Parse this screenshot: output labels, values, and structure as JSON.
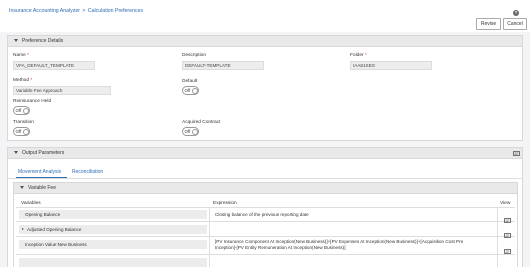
{
  "breadcrumb": {
    "root": "Insurance Accounting Analyzer",
    "sep": ">",
    "current": "Calculation Preferences"
  },
  "help_glyph": "?",
  "actions": {
    "revise": "Revise",
    "cancel": "Cancel"
  },
  "preference_details": {
    "title": "Preference Details",
    "name_label": "Name",
    "name_value": "VFA_DEFAULT_TEMPLATE",
    "description_label": "Description",
    "description_value": "DEFAULT-TEMPLATE",
    "folder_label": "Folder",
    "folder_value": "IAA81SEG",
    "method_label": "Method",
    "method_value": "Variable Fee Approach",
    "default_label": "Default",
    "default_value": "Off",
    "reinsurance_label": "Reinsurance Held",
    "reinsurance_value": "Off",
    "transition_label": "Transition",
    "transition_value": "Off",
    "acquired_label": "Acquired Contract",
    "acquired_value": "Off",
    "required_mark": "*"
  },
  "output_parameters": {
    "title": "Output Parameters",
    "tabs": [
      "Movement Analysis",
      "Reconciliation"
    ],
    "section_title": "Variable Fee",
    "columns": {
      "variables": "Variables",
      "expression": "Expression",
      "view": "View"
    },
    "rows": [
      {
        "variable": "Opening Balance",
        "expression": "Closing balance of the previous reporting date"
      },
      {
        "variable": "Adjusted Opening Balance",
        "expression": ""
      },
      {
        "variable": "Inception Value:New Business",
        "expression_lines": [
          "[PV Insurance Component At Inception(New Business)]+[PV Expenses At Inception(New Business)]+[Acquisition Cost Pre",
          "Inception]-[PV Entity Remuneration At Inception(New Business)]"
        ]
      }
    ]
  },
  "colors": {
    "accent": "#2f6db5",
    "panel_header": "#e9e9e9",
    "input_bg": "#ededed"
  },
  "icons": [
    "help-icon",
    "caret-down-icon",
    "comment-icon",
    "caret-right-icon",
    "view-icon"
  ]
}
